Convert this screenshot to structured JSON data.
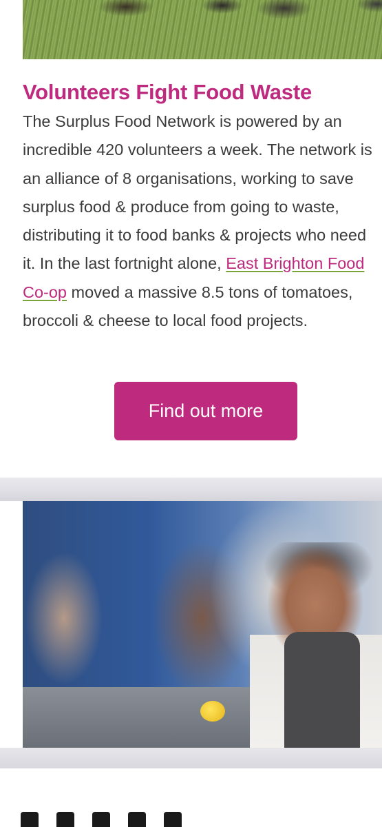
{
  "story": {
    "headline": "Volunteers Fight Food Waste",
    "body_before_link": "The Surplus Food Network is powered by an incredible 420 volunteers a week. The network is an alliance of 8 organisations, working to save surplus food & produce from going to waste, distributing it to food banks & projects who need it. In the last fortnight alone, ",
    "link_text": "East Brighton Food Co-op",
    "body_after_link": " moved a massive 8.5 tons of tomatoes, broccoli & cheese to local food projects.",
    "button_label": "Find out more"
  },
  "colors": {
    "accent": "#be2a7e",
    "body_text": "#3b3b3b",
    "link_underline": "#7aa33a"
  }
}
